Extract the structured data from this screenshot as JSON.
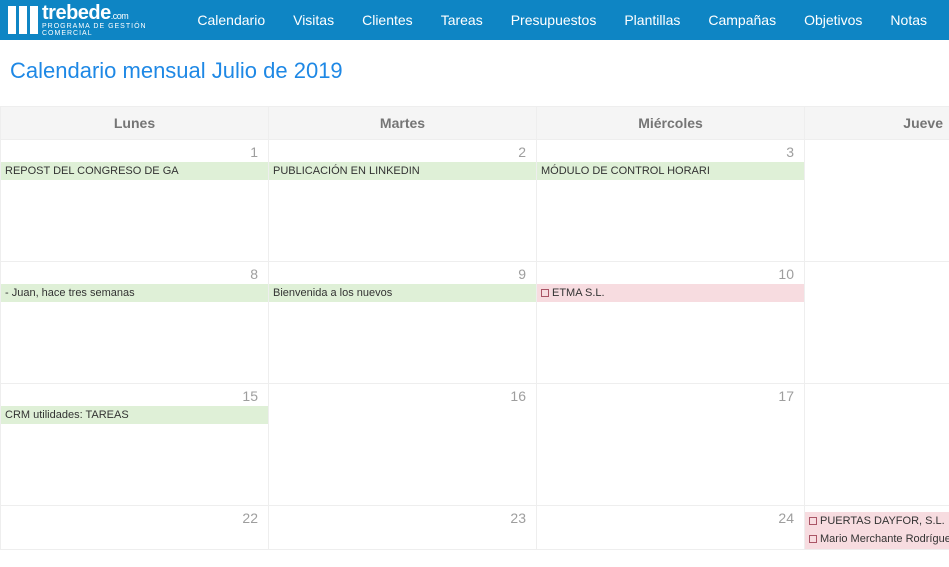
{
  "brand": {
    "name": "trebede",
    "tld": ".com",
    "subtitle": "PROGRAMA DE GESTIÓN COMERCIAL"
  },
  "nav": [
    "Calendario",
    "Visitas",
    "Clientes",
    "Tareas",
    "Presupuestos",
    "Plantillas",
    "Campañas",
    "Objetivos",
    "Notas"
  ],
  "title": "Calendario mensual Julio de 2019",
  "headers": {
    "lunes": "Lunes",
    "martes": "Martes",
    "miercoles": "Miércoles",
    "jueves": "Jueve"
  },
  "weeks": [
    {
      "lunes": {
        "num": "1",
        "events": [
          {
            "text": "REPOST DEL CONGRESO DE GA",
            "type": "green"
          }
        ]
      },
      "martes": {
        "num": "2",
        "events": [
          {
            "text": "PUBLICACIÓN EN LINKEDIN",
            "type": "green"
          }
        ]
      },
      "miercoles": {
        "num": "3",
        "events": [
          {
            "text": "MÓDULO DE CONTROL HORARI",
            "type": "green"
          }
        ]
      },
      "jueves": {
        "num": "",
        "events": []
      }
    },
    {
      "lunes": {
        "num": "8",
        "events": [
          {
            "text": "- Juan, hace tres semanas",
            "type": "green"
          }
        ]
      },
      "martes": {
        "num": "9",
        "events": [
          {
            "text": "Bienvenida a los nuevos",
            "type": "green"
          }
        ]
      },
      "miercoles": {
        "num": "10",
        "events": [
          {
            "text": "ETMA S.L.",
            "type": "pink",
            "chk": true
          }
        ]
      },
      "jueves": {
        "num": "",
        "events": []
      }
    },
    {
      "lunes": {
        "num": "15",
        "events": [
          {
            "text": "CRM utilidades: TAREAS",
            "type": "green"
          }
        ]
      },
      "martes": {
        "num": "16",
        "events": []
      },
      "miercoles": {
        "num": "17",
        "events": []
      },
      "jueves": {
        "num": "",
        "events": []
      }
    },
    {
      "lunes": {
        "num": "22",
        "events": []
      },
      "martes": {
        "num": "23",
        "events": []
      },
      "miercoles": {
        "num": "24",
        "events": []
      },
      "jueves": {
        "num": "",
        "events": [
          {
            "text": "PUERTAS DAYFOR, S.L.",
            "type": "pink",
            "chk": true
          },
          {
            "text": "Mario Merchante Rodríguez",
            "type": "pink",
            "chk": true
          }
        ]
      }
    }
  ]
}
